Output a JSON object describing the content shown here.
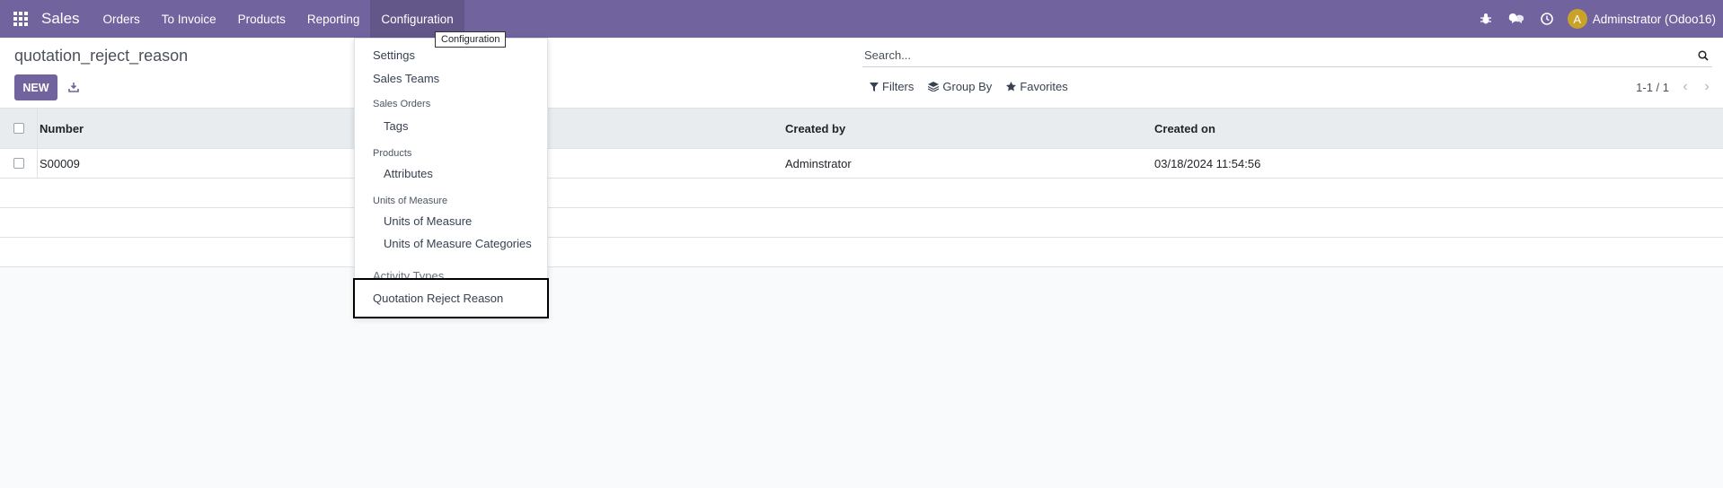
{
  "navbar": {
    "brand": "Sales",
    "menu": [
      "Orders",
      "To Invoice",
      "Products",
      "Reporting",
      "Configuration"
    ],
    "user": "Adminstrator (Odoo16)",
    "avatar_letter": "A"
  },
  "tooltip": "Configuration",
  "control": {
    "breadcrumb": "quotation_reject_reason",
    "new_label": "NEW",
    "search_placeholder": "Search...",
    "filters_label": "Filters",
    "group_by_label": "Group By",
    "favorites_label": "Favorites",
    "pager": "1-1 / 1"
  },
  "table": {
    "headers": [
      "Number",
      "Created by",
      "Created on"
    ],
    "rows": [
      {
        "number": "S00009",
        "created_by": "Adminstrator",
        "created_on": "03/18/2024 11:54:56"
      }
    ]
  },
  "dropdown": {
    "settings": "Settings",
    "sales_teams": "Sales Teams",
    "sales_orders_header": "Sales Orders",
    "tags": "Tags",
    "products_header": "Products",
    "attributes": "Attributes",
    "uom_header": "Units of Measure",
    "uom": "Units of Measure",
    "uom_categories": "Units of Measure Categories",
    "activity_types": "Activity Types",
    "quotation_reject_reason": "Quotation Reject Reason"
  },
  "colors": {
    "primary": "#71639e",
    "avatar": "#c9a227"
  }
}
